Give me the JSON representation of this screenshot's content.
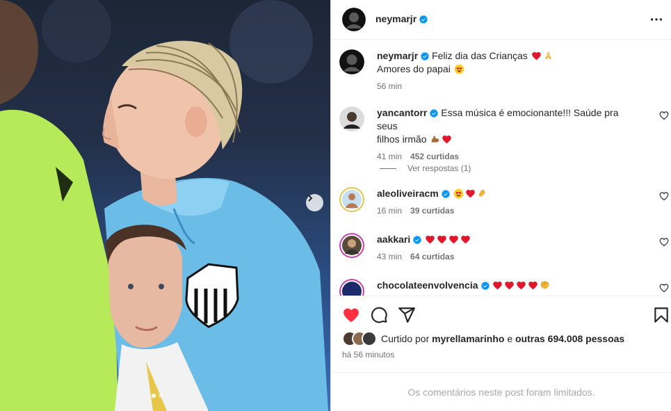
{
  "post": {
    "author": "neymarjr",
    "caption_line1": "Feliz dia das Crianças",
    "caption_line2": "Amores do papai",
    "caption_time": "56 min"
  },
  "comments": [
    {
      "user": "yancantorr",
      "text1": "Essa música é emocionante!!! Saúde pra seus",
      "text2": "filhos irmão",
      "time": "41 min",
      "likes": "452 curtidas"
    },
    {
      "user": "aleoliveiracm",
      "time": "16 min",
      "likes": "39 curtidas"
    },
    {
      "user": "aakkari",
      "time": "43 min",
      "likes": "64 curtidas"
    },
    {
      "user": "chocolateenvolvencia"
    }
  ],
  "view_replies": "Ver respostas (1)",
  "liked_by": {
    "prefix": "Curtido por",
    "user": "myrellamarinho",
    "middle": "e",
    "others": "outras 694.008 pessoas"
  },
  "post_time": "há 56 minutos",
  "comments_limited": "Os comentários neste post foram limitados.",
  "colors": {
    "heart_red": "#ff3040",
    "verified_blue": "#0095f6",
    "jersey_blue": "#6bbde8",
    "referee_green": "#b6ea58"
  },
  "icons": [
    "next-arrow-icon",
    "more-options-icon",
    "verified-icon",
    "heart-icon",
    "comment-icon",
    "share-icon",
    "bookmark-icon"
  ]
}
